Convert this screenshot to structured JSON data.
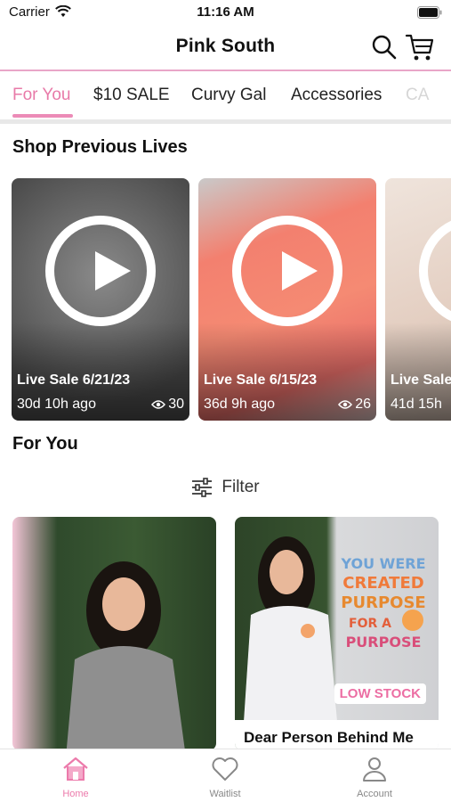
{
  "status_bar": {
    "carrier": "Carrier",
    "time": "11:16 AM"
  },
  "header": {
    "title": "Pink South",
    "search_icon": "search-icon",
    "cart_icon": "cart-icon"
  },
  "tabs": [
    {
      "label": "For You",
      "active": true
    },
    {
      "label": "$10 SALE"
    },
    {
      "label": "Curvy Gal"
    },
    {
      "label": "Accessories"
    },
    {
      "label": "CA"
    }
  ],
  "sections": {
    "previous_lives": "Shop Previous Lives",
    "for_you": "For You"
  },
  "lives": [
    {
      "name": "Live Sale 6/21/23",
      "ago": "30d 10h ago",
      "views": "30"
    },
    {
      "name": "Live Sale 6/15/23",
      "ago": "36d 9h ago",
      "views": "26"
    },
    {
      "name": "Live Sale",
      "ago": "41d 15h"
    }
  ],
  "filter": {
    "label": "Filter",
    "icon": "sliders-icon"
  },
  "products": [
    {
      "name": ""
    },
    {
      "name": "Dear Person Behind Me",
      "badge": "LOW STOCK"
    }
  ],
  "bottom_nav": [
    {
      "label": "Home",
      "icon": "home-icon",
      "active": true
    },
    {
      "label": "Waitlist",
      "icon": "heart-icon"
    },
    {
      "label": "Account",
      "icon": "person-icon"
    }
  ],
  "colors": {
    "accent": "#ec7aab",
    "header_rule": "#e9a6c8"
  }
}
